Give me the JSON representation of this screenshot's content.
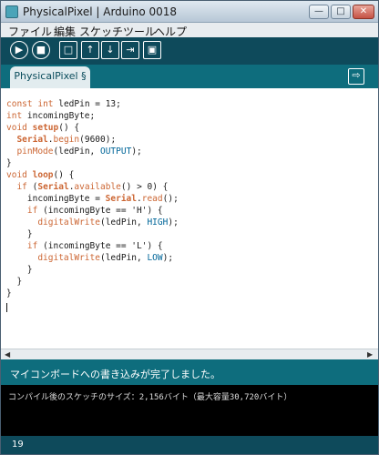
{
  "window": {
    "title": "PhysicalPixel | Arduino 0018",
    "min_label": "—",
    "max_label": "□",
    "close_label": "✕"
  },
  "menu": {
    "items": [
      "ファイル",
      "編集",
      "スケッチ",
      "ツール",
      "ヘルプ"
    ]
  },
  "toolbar": {
    "buttons": [
      {
        "name": "verify",
        "icon": "▶"
      },
      {
        "name": "stop",
        "icon": "■"
      },
      {
        "name": "new",
        "icon": "□"
      },
      {
        "name": "open",
        "icon": "↑"
      },
      {
        "name": "save",
        "icon": "↓"
      },
      {
        "name": "upload",
        "icon": "⇥"
      },
      {
        "name": "serial-monitor",
        "icon": "▣"
      }
    ]
  },
  "tabs": {
    "active": "PhysicalPixel §",
    "tab_menu_icon": "⇨"
  },
  "editor": {
    "lines": [
      "const int ledPin = 13;",
      "int incomingByte;",
      "void setup() {",
      "  Serial.begin(9600);",
      "  pinMode(ledPin, OUTPUT);",
      "}",
      "void loop() {",
      "  if (Serial.available() > 0) {",
      "    incomingByte = Serial.read();",
      "    if (incomingByte == 'H') {",
      "      digitalWrite(ledPin, HIGH);",
      "    }",
      "    if (incomingByte == 'L') {",
      "      digitalWrite(ledPin, LOW);",
      "    }",
      "  }",
      "}"
    ]
  },
  "status": {
    "message": "マイコンボードへの書き込みが完了しました。"
  },
  "console": {
    "output": "コンパイル後のスケッチのサイズ：2,156バイト（最大容量30,720バイト）"
  },
  "footer": {
    "line_number": "19"
  },
  "colors": {
    "toolbar_bg": "#0e4a5b",
    "tabstrip_bg": "#0e6d7d",
    "keyword": "#cc6633",
    "constant": "#006699"
  }
}
